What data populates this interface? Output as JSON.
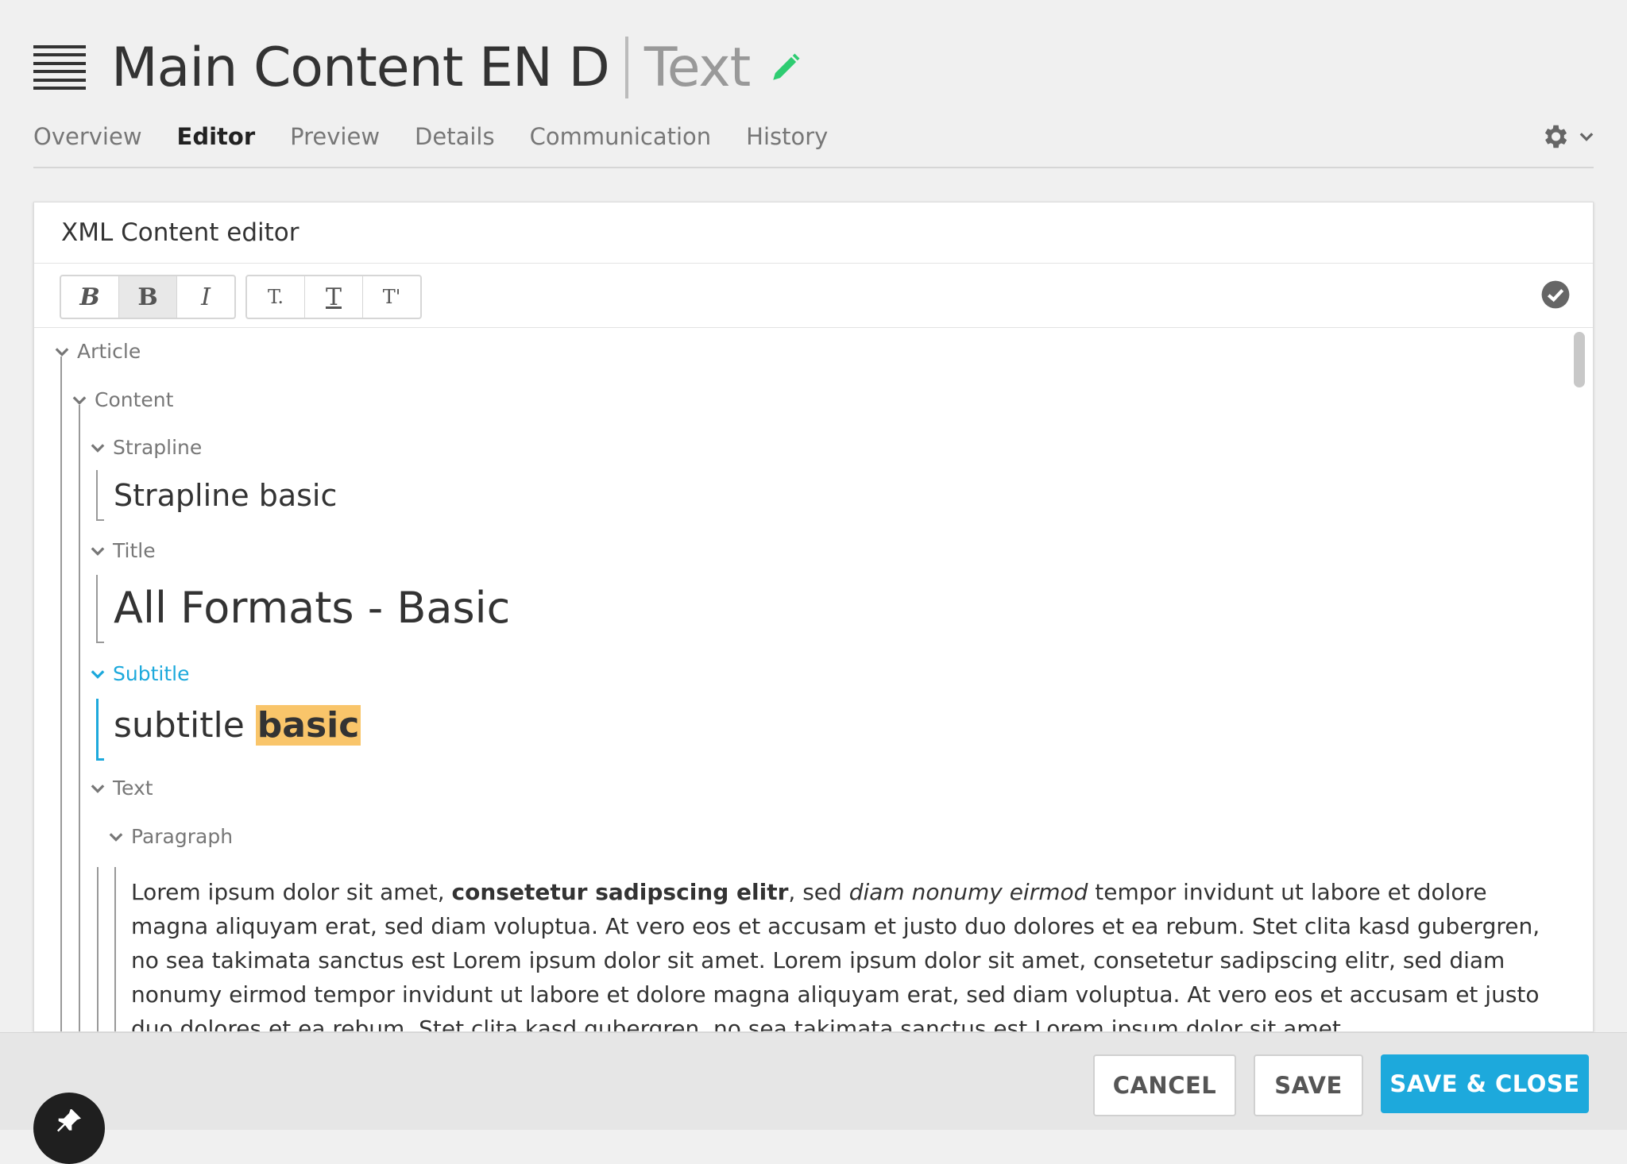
{
  "header": {
    "title": "Main Content EN D",
    "type_label": "Text"
  },
  "tabs": [
    "Overview",
    "Editor",
    "Preview",
    "Details",
    "Communication",
    "History"
  ],
  "active_tab": "Editor",
  "panel": {
    "title": "XML Content editor"
  },
  "toolbar": {
    "buttons": [
      "B",
      "B",
      "I",
      "T.",
      "T",
      "T'"
    ]
  },
  "tree": {
    "article": "Article",
    "content": "Content",
    "strapline_label": "Strapline",
    "strapline_value": "Strapline basic",
    "title_label": "Title",
    "title_value": "All Formats - Basic",
    "subtitle_label": "Subtitle",
    "subtitle_value_plain": "subtitle ",
    "subtitle_value_bold": "basic",
    "text_label": "Text",
    "paragraph_label": "Paragraph",
    "paragraph": {
      "p1": "Lorem ipsum dolor sit amet, ",
      "p2_bold": "consetetur sadipscing elitr",
      "p3": ", sed ",
      "p4_italic": "diam nonumy eirmod",
      "p5": " tempor invidunt ut labore et dolore magna aliquyam erat, sed diam voluptua. At vero eos et accusam et justo duo dolores et ea rebum. Stet clita kasd gubergren, no sea takimata sanctus est Lorem ipsum dolor sit amet. Lorem ipsum dolor sit amet, consetetur sadipscing elitr, sed diam nonumy eirmod tempor invidunt ut labore et dolore magna aliquyam erat, sed diam voluptua. At vero eos et accusam et justo duo dolores et ea rebum. Stet clita kasd gubergren, no sea takimata sanctus est Lorem ipsum dolor sit amet.."
    }
  },
  "footer": {
    "cancel": "CANCEL",
    "save": "SAVE",
    "save_close": "SAVE & CLOSE"
  },
  "colors": {
    "accent": "#1da9dc",
    "highlight": "#f9c56a",
    "pencil": "#2ecc71"
  },
  "icons": [
    "menu-icon",
    "pencil-icon",
    "gear-icon",
    "chevron-down-icon",
    "check-circle-icon",
    "pin-icon"
  ]
}
